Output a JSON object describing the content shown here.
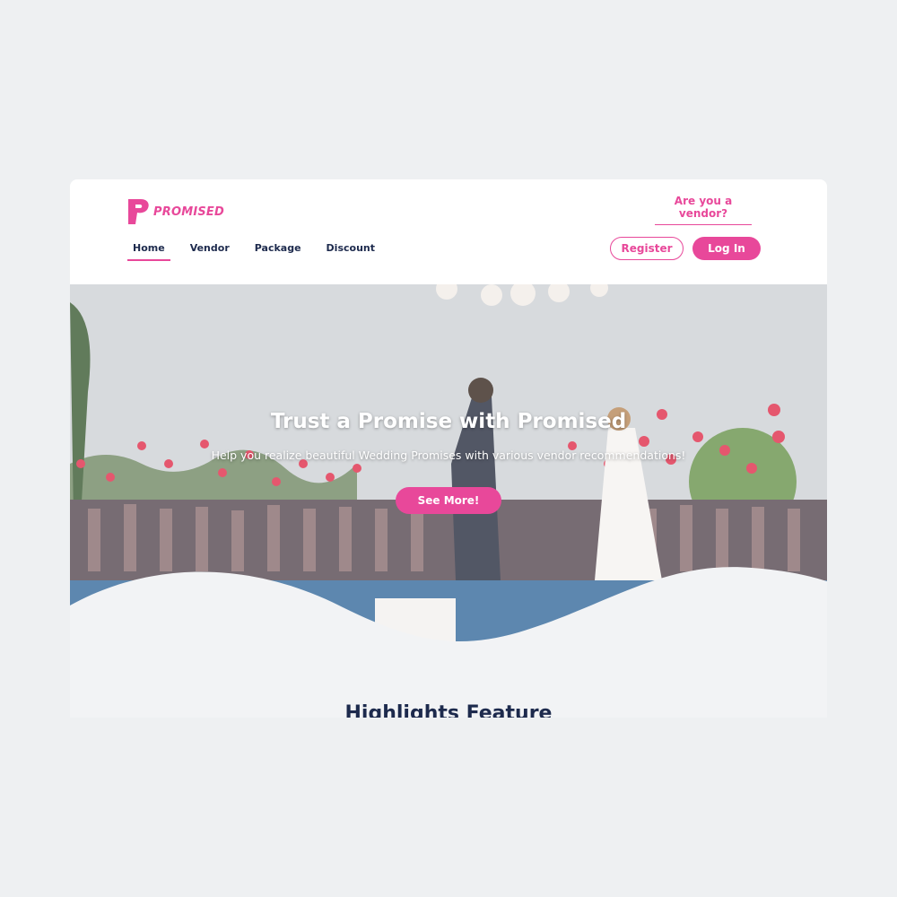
{
  "brand": {
    "name": "PROMISED",
    "color": "#e8489a",
    "icon": "promised-logo-icon"
  },
  "header": {
    "vendor_link": "Are you a vendor?",
    "nav": [
      {
        "label": "Home",
        "active": true
      },
      {
        "label": "Vendor",
        "active": false
      },
      {
        "label": "Package",
        "active": false
      },
      {
        "label": "Discount",
        "active": false
      }
    ],
    "register_label": "Register",
    "login_label": "Log In"
  },
  "hero": {
    "title": "Trust a Promise with Promised",
    "subtitle": "Help you realize beautiful Wedding Promises with various vendor recommendations!",
    "cta_label": "See More!"
  },
  "highlights": {
    "title": "Highlights Feature"
  },
  "colors": {
    "accent": "#e8489a",
    "navy": "#1d2a4d",
    "page_bg": "#eef0f2"
  }
}
